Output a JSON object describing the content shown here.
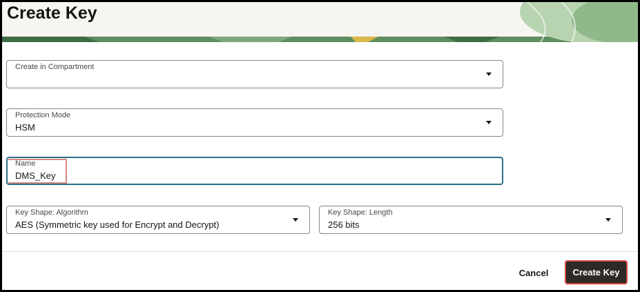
{
  "dialog": {
    "title": "Create Key"
  },
  "form": {
    "compartment": {
      "label": "Create in Compartment",
      "value": ""
    },
    "protection_mode": {
      "label": "Protection Mode",
      "value": "HSM"
    },
    "name": {
      "label": "Name",
      "value": "DMS_Key"
    },
    "algorithm": {
      "label": "Key Shape: Algorithm",
      "value": "AES (Symmetric key used for Encrypt and Decrypt)"
    },
    "length": {
      "label": "Key Shape: Length",
      "value": "256 bits"
    }
  },
  "footer": {
    "cancel_label": "Cancel",
    "create_label": "Create Key"
  },
  "colors": {
    "primary_button": "#2d2a27",
    "highlight": "#d44a3d",
    "focus": "#2b6e86",
    "header_green": "#4f7d52"
  }
}
